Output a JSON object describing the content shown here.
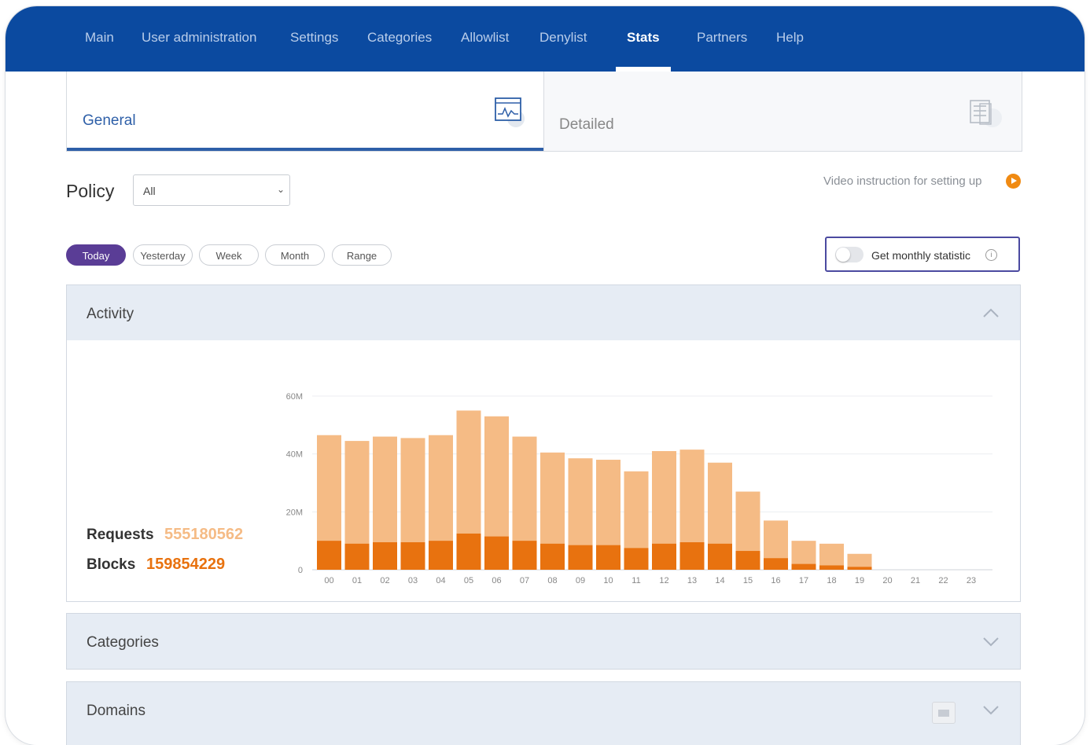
{
  "nav": {
    "items": [
      {
        "label": "Main",
        "active": false
      },
      {
        "label": "User administration",
        "active": false
      },
      {
        "label": "Settings",
        "active": false
      },
      {
        "label": "Categories",
        "active": false
      },
      {
        "label": "Allowlist",
        "active": false
      },
      {
        "label": "Denylist",
        "active": false
      },
      {
        "label": "Stats",
        "active": true
      },
      {
        "label": "Partners",
        "active": false
      },
      {
        "label": "Help",
        "active": false
      }
    ]
  },
  "tabs": {
    "general": {
      "label": "General",
      "icon": "chart-icon",
      "active": true
    },
    "detailed": {
      "label": "Detailed",
      "icon": "document-icon",
      "active": false
    }
  },
  "policy": {
    "label": "Policy",
    "selected": "All"
  },
  "video": {
    "label": "Video instruction for setting up",
    "icon": "play-icon"
  },
  "periods": [
    {
      "label": "Today",
      "active": true
    },
    {
      "label": "Yesterday",
      "active": false
    },
    {
      "label": "Week",
      "active": false
    },
    {
      "label": "Month",
      "active": false
    },
    {
      "label": "Range",
      "active": false
    }
  ],
  "monthly": {
    "label": "Get monthly statistic",
    "enabled": false,
    "info_icon": "info-icon"
  },
  "panels": {
    "activity": {
      "title": "Activity",
      "expanded": true
    },
    "categories": {
      "title": "Categories",
      "expanded": false
    },
    "domains": {
      "title": "Domains",
      "expanded": false
    }
  },
  "totals": {
    "requests_label": "Requests",
    "requests_value": "555180562",
    "blocks_label": "Blocks",
    "blocks_value": "159854229"
  },
  "colors": {
    "nav_bg": "#0b4aa0",
    "requests": "#f5bb85",
    "blocks": "#e8720f",
    "active_period": "#5a3d96",
    "video_icon": "#f08a12"
  },
  "chart_data": {
    "type": "bar",
    "stacked": true,
    "categories": [
      "00",
      "01",
      "02",
      "03",
      "04",
      "05",
      "06",
      "07",
      "08",
      "09",
      "10",
      "11",
      "12",
      "13",
      "14",
      "15",
      "16",
      "17",
      "18",
      "19",
      "20",
      "21",
      "22",
      "23"
    ],
    "series": [
      {
        "values": [
          46.5,
          44.5,
          46,
          45.5,
          46.5,
          55,
          53,
          46,
          40.5,
          38.5,
          38,
          34,
          41,
          41.5,
          37,
          27,
          17,
          10,
          9,
          5.5,
          0,
          0,
          0,
          0
        ]
      },
      {
        "values": [
          10,
          9,
          9.5,
          9.5,
          10,
          12.5,
          11.5,
          10,
          9,
          8.5,
          8.5,
          7.5,
          9,
          9.5,
          9,
          6.5,
          4,
          2,
          1.5,
          1,
          0,
          0,
          0,
          0
        ]
      }
    ],
    "yticks": [
      "0",
      "20M",
      "40M",
      "60M"
    ],
    "ylim": [
      0,
      60
    ],
    "grid": true
  }
}
